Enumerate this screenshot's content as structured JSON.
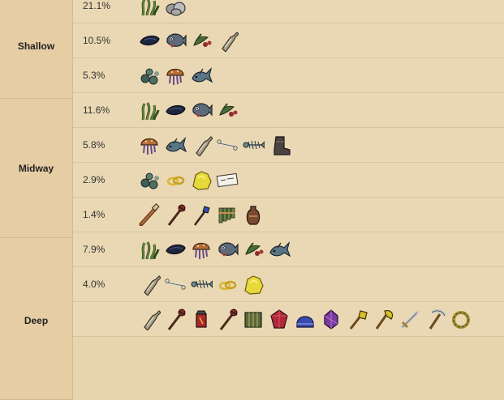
{
  "zones": [
    {
      "label": "Shallow"
    },
    {
      "label": "Midway"
    },
    {
      "label": "Deep"
    }
  ],
  "rows": [
    {
      "percent": "21.1%",
      "items": [
        "kelp",
        "rocks"
      ]
    },
    {
      "percent": "10.5%",
      "items": [
        "mussel",
        "fish",
        "seaweed",
        "bottle"
      ]
    },
    {
      "percent": "5.3%",
      "items": [
        "kelp-green",
        "jellyfish",
        "fish-small"
      ]
    },
    {
      "percent": "11.6%",
      "items": [
        "kelp",
        "mussel",
        "fish",
        "seaweed"
      ]
    },
    {
      "percent": "5.8%",
      "items": [
        "jellyfish",
        "fish-small",
        "bottle",
        "bones",
        "fishbone",
        "boot"
      ]
    },
    {
      "percent": "2.9%",
      "items": [
        "kelp-green",
        "ring",
        "gold-nugget",
        "note"
      ]
    },
    {
      "percent": "1.4%",
      "items": [
        "telescope",
        "staff",
        "wand",
        "panflute",
        "vase"
      ]
    },
    {
      "percent": "7.9%",
      "items": [
        "kelp",
        "mussel",
        "jellyfish",
        "fish",
        "seaweed",
        "fish-small"
      ]
    },
    {
      "percent": "4.0%",
      "items": [
        "bottle",
        "bones",
        "fishbone",
        "ring",
        "gold-nugget"
      ]
    },
    {
      "percent": "",
      "items": [
        "bottle",
        "staff",
        "lantern",
        "staff",
        "cage",
        "gem-red",
        "helmet",
        "gem-purple",
        "shovel",
        "axe",
        "sword",
        "pickaxe",
        "wreath"
      ]
    }
  ]
}
